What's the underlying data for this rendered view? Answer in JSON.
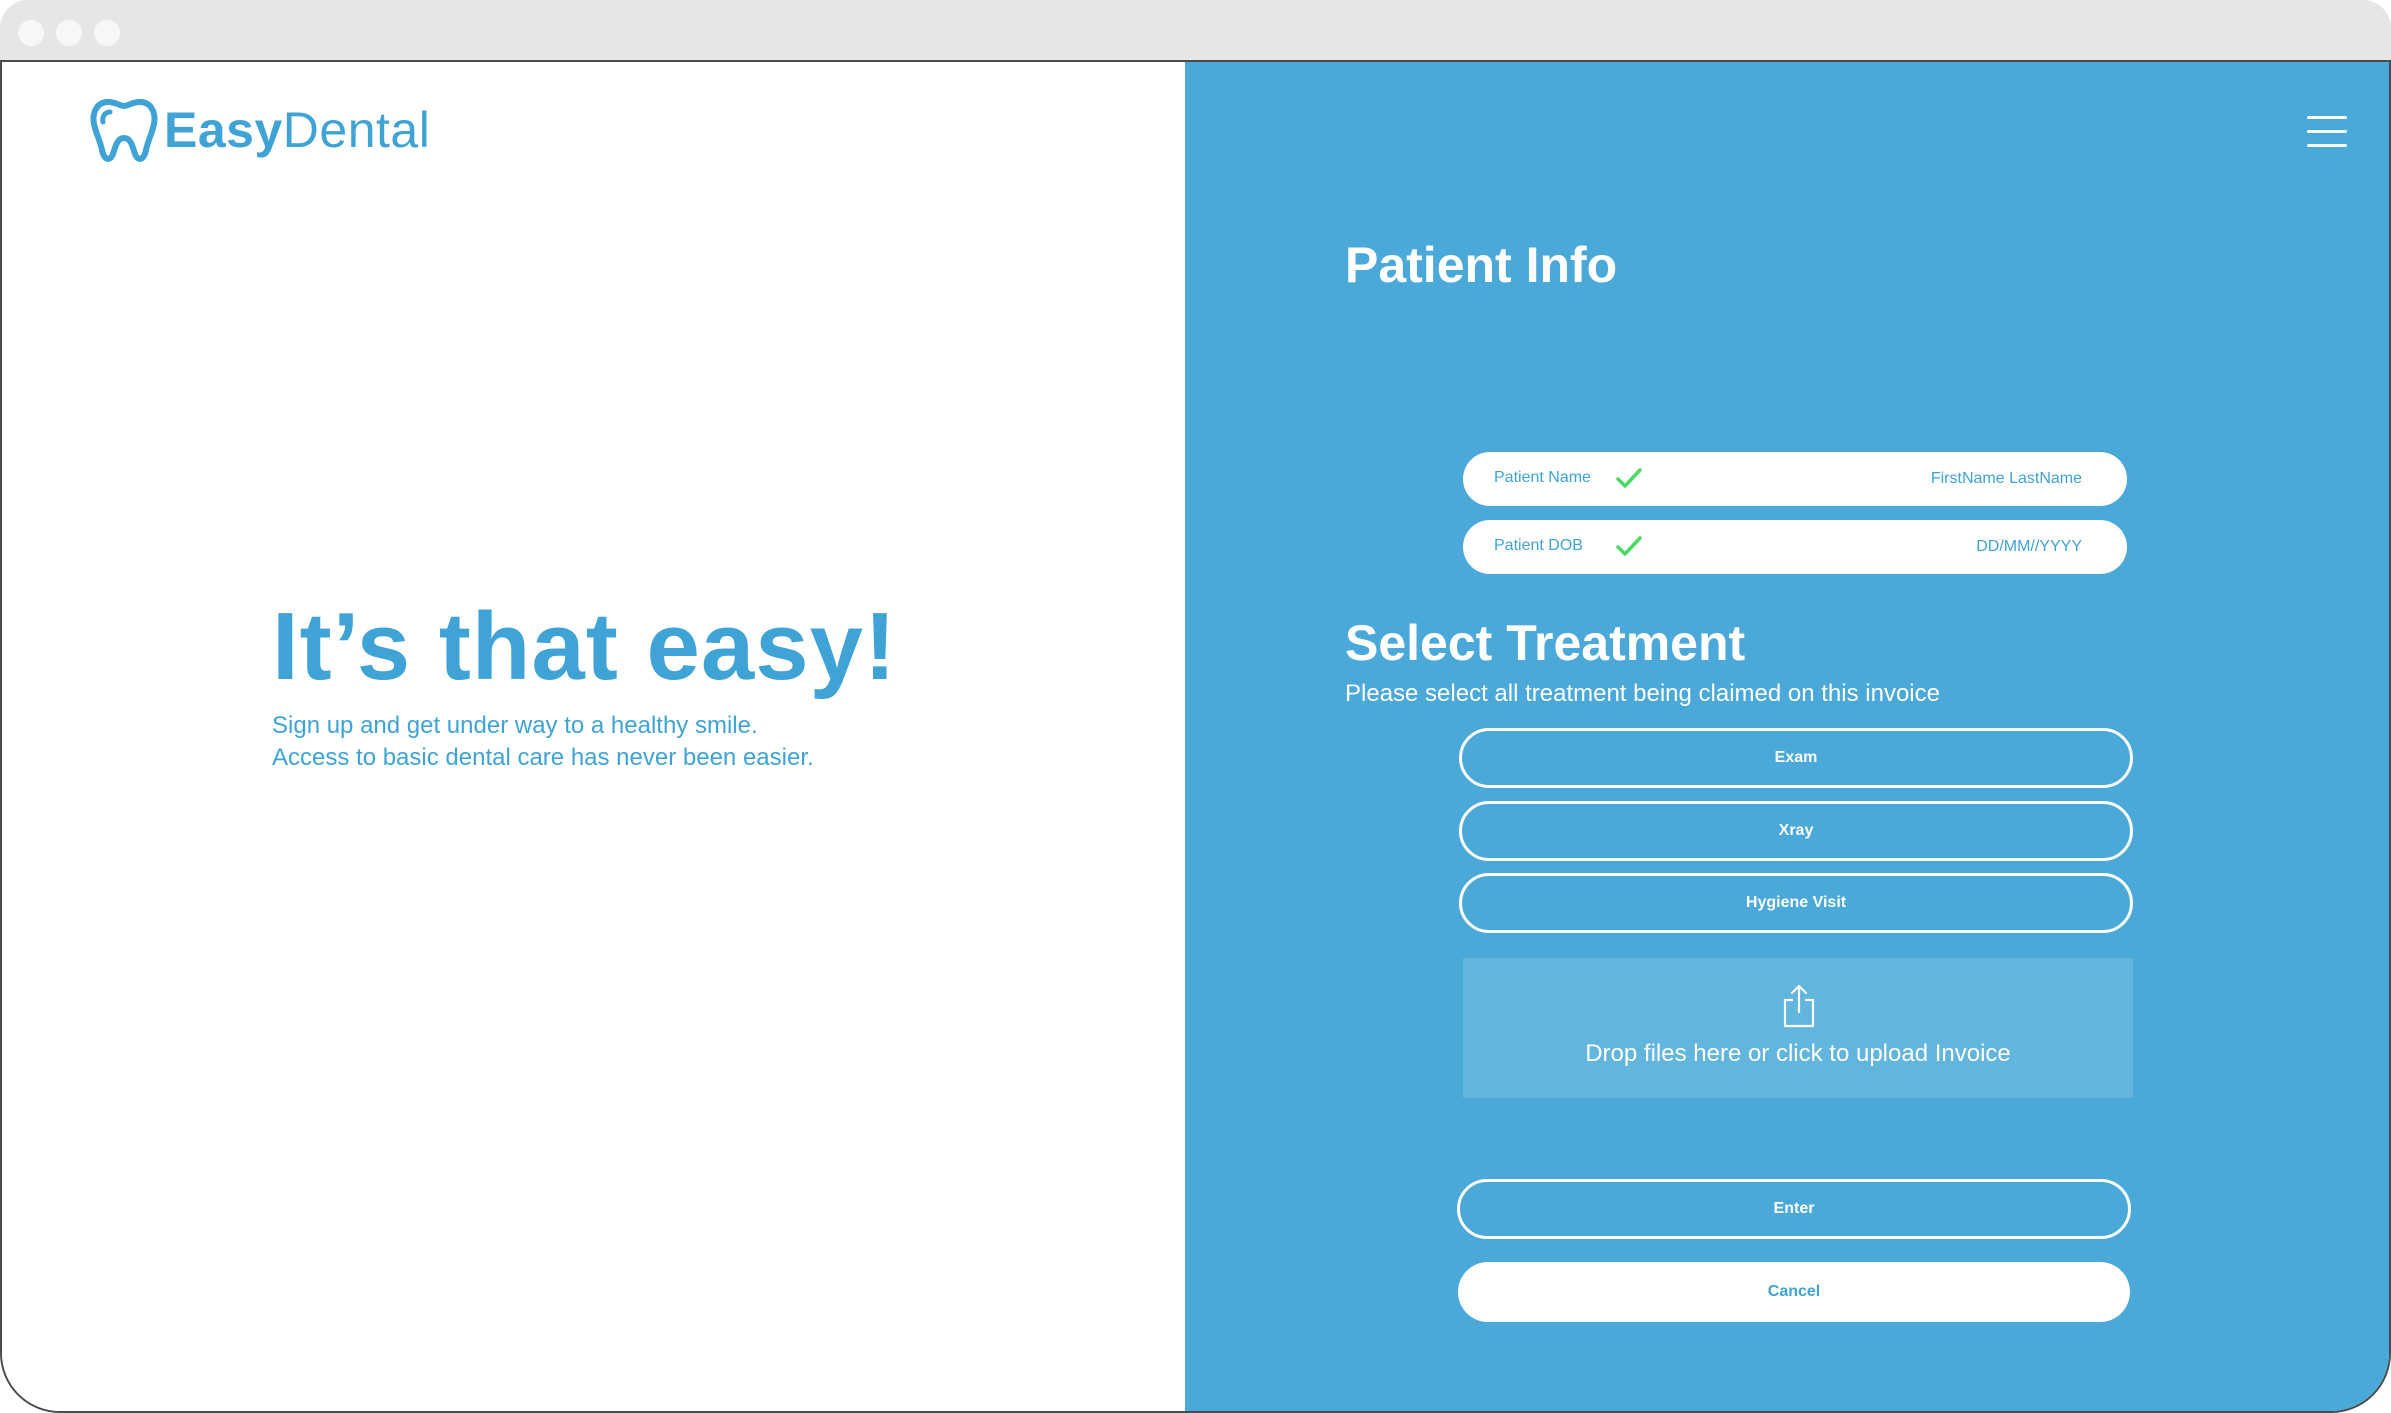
{
  "brand": {
    "name_part1": "Easy",
    "name_part2": "Dental"
  },
  "hero": {
    "title": "It’s that easy!",
    "subtitle_line1": "Sign up and get under way to a healthy smile.",
    "subtitle_line2": "Access to basic dental care has never been easier."
  },
  "patient_info": {
    "title": "Patient Info",
    "fields": [
      {
        "label": "Patient Name",
        "value": "FirstName LastName",
        "verified": true
      },
      {
        "label": "Patient DOB",
        "value": "DD/MM//YYYY",
        "verified": true
      }
    ]
  },
  "treatment": {
    "title": "Select Treatment",
    "description": "Please select all treatment being claimed on this invoice",
    "options": [
      "Exam",
      "Xray",
      "Hygiene Visit"
    ]
  },
  "upload": {
    "text": "Drop files here or click to upload Invoice"
  },
  "actions": {
    "enter_label": "Enter",
    "cancel_label": "Cancel"
  },
  "colors": {
    "brand_blue": "#3fa3d6",
    "panel_blue": "#4aa9d8",
    "upload_bg": "#62b5dd",
    "check_green": "#4cd964",
    "white": "#ffffff"
  },
  "icons": {
    "menu": "hamburger-icon",
    "check": "checkmark-icon",
    "upload": "share-upload-icon",
    "logo": "tooth-icon"
  }
}
